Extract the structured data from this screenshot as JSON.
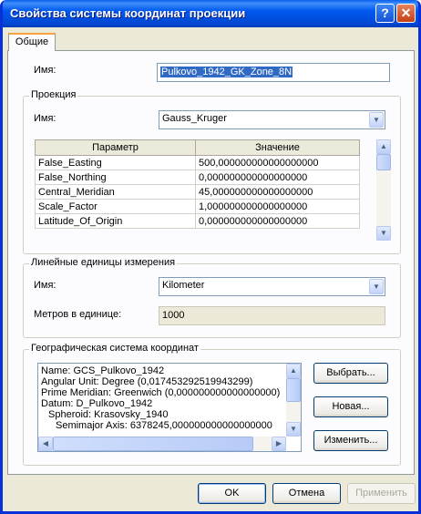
{
  "window": {
    "title": "Свойства системы координат проекции",
    "help_label": "?",
    "close_label": "✕"
  },
  "tabs": [
    {
      "label": "Общие"
    }
  ],
  "general": {
    "name_label": "Имя:",
    "name_value": "Pulkovo_1942_GK_Zone_8N"
  },
  "projection": {
    "group_title": "Проекция",
    "name_label": "Имя:",
    "name_value": "Gauss_Kruger",
    "table": {
      "columns": [
        "Параметр",
        "Значение"
      ],
      "rows": [
        [
          "False_Easting",
          "500,000000000000000000"
        ],
        [
          "False_Northing",
          "0,000000000000000000"
        ],
        [
          "Central_Meridian",
          "45,000000000000000000"
        ],
        [
          "Scale_Factor",
          "1,000000000000000000"
        ],
        [
          "Latitude_Of_Origin",
          "0,000000000000000000"
        ]
      ]
    }
  },
  "linear_units": {
    "group_title": "Линейные единицы измерения",
    "name_label": "Имя:",
    "name_value": "Kilometer",
    "meters_label": "Метров в единице:",
    "meters_value": "1000"
  },
  "geographic": {
    "group_title": "Географическая система координат",
    "lines": [
      "Name: GCS_Pulkovo_1942",
      "Angular Unit: Degree (0,017453292519943299)",
      "Prime Meridian: Greenwich (0,000000000000000000)",
      "Datum: D_Pulkovo_1942",
      "  Spheroid: Krasovsky_1940",
      "    Semimajor Axis: 6378245,000000000000000000"
    ],
    "select_button": "Выбрать...",
    "new_button": "Новая...",
    "edit_button": "Изменить..."
  },
  "footer": {
    "ok": "OK",
    "cancel": "Отмена",
    "apply": "Применить"
  },
  "colors": {
    "title_bar": "#0058ee",
    "selection": "#316ac5",
    "dialog_bg": "#ece9d8"
  }
}
